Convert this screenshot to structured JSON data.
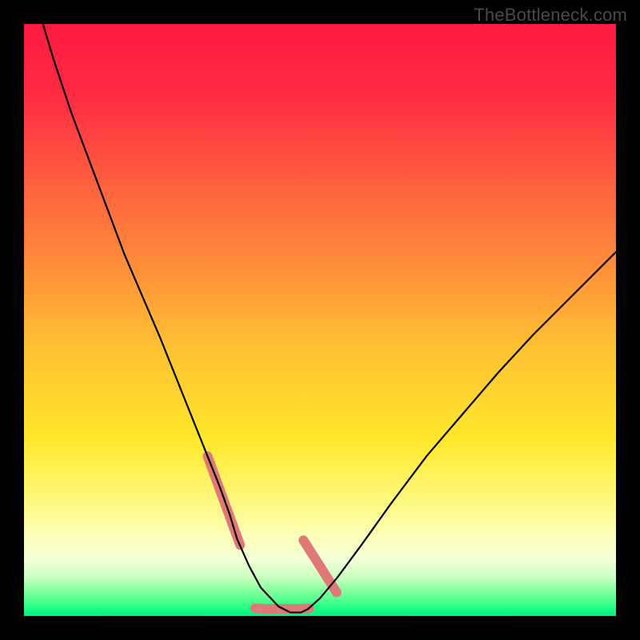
{
  "watermark": "TheBottleneck.com",
  "gradient": {
    "stops": [
      {
        "offset": 0.0,
        "color": "#ff1a40"
      },
      {
        "offset": 0.12,
        "color": "#ff2b42"
      },
      {
        "offset": 0.28,
        "color": "#ff643f"
      },
      {
        "offset": 0.4,
        "color": "#ff8b3b"
      },
      {
        "offset": 0.55,
        "color": "#ffc233"
      },
      {
        "offset": 0.7,
        "color": "#ffe72a"
      },
      {
        "offset": 0.8,
        "color": "#fff87a"
      },
      {
        "offset": 0.86,
        "color": "#fdffb4"
      },
      {
        "offset": 0.905,
        "color": "#f4ffd6"
      },
      {
        "offset": 0.935,
        "color": "#c8ffbf"
      },
      {
        "offset": 0.96,
        "color": "#7dff9a"
      },
      {
        "offset": 0.985,
        "color": "#26ff86"
      },
      {
        "offset": 1.0,
        "color": "#05f07a"
      }
    ]
  },
  "chart_data": {
    "type": "line",
    "title": "",
    "xlabel": "",
    "ylabel": "",
    "xlim": [
      0,
      100
    ],
    "ylim": [
      0,
      100
    ],
    "grid": false,
    "legend": false,
    "series": [
      {
        "name": "curve",
        "color": "#000000",
        "stroke_width": 2.2,
        "x": [
          3.2,
          5,
          8,
          11,
          14,
          17,
          20,
          23,
          25,
          27,
          29,
          31,
          33,
          34.7,
          36,
          38,
          40,
          43,
          45,
          46.8,
          48,
          50,
          53,
          57,
          62,
          68,
          74,
          80,
          86,
          92,
          98,
          100
        ],
        "y": [
          100,
          94,
          85,
          77,
          69,
          61,
          54,
          47,
          42,
          37,
          32,
          27,
          22,
          17.3,
          13,
          8.5,
          4.8,
          1.6,
          0.6,
          0.6,
          1.2,
          3.0,
          6.6,
          12,
          19,
          27,
          34,
          41,
          47.5,
          53.5,
          59.5,
          61.5
        ]
      },
      {
        "name": "marker-segments",
        "color": "#e07878",
        "stroke_width": 12,
        "linecap": "round",
        "segments": [
          {
            "x": [
              31.0,
              32.1,
              33.2,
              34.3,
              35.4,
              36.5
            ],
            "y": [
              27.0,
              24.0,
              21.0,
              18.0,
              15.0,
              12.0
            ]
          },
          {
            "x": [
              39.0,
              41.3,
              43.6,
              45.9,
              48.2
            ],
            "y": [
              1.3,
              1.2,
              1.2,
              1.2,
              1.3
            ]
          },
          {
            "x": [
              47.2,
              48.6,
              50.0,
              51.4,
              52.8
            ],
            "y": [
              12.8,
              10.6,
              8.4,
              6.2,
              4.0
            ]
          }
        ]
      }
    ],
    "annotations": []
  }
}
